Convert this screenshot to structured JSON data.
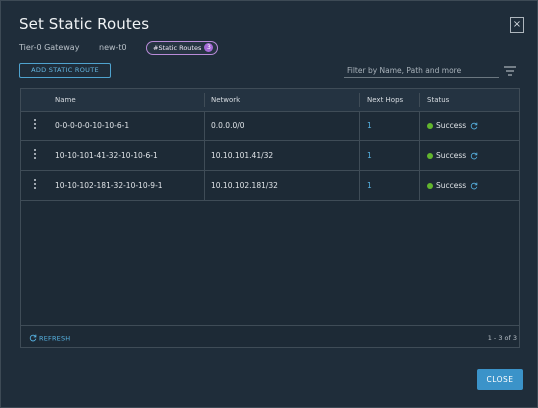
{
  "dialog": {
    "title": "Set Static Routes",
    "close_icon": "×"
  },
  "gateway": {
    "label": "Tier-0 Gateway",
    "value": "new-t0",
    "chip_label": "#Static Routes",
    "chip_count": "3"
  },
  "toolbar": {
    "add_label": "ADD STATIC ROUTE",
    "filter_placeholder": "Filter by Name, Path and more",
    "filter_icon": "filter-icon"
  },
  "table": {
    "columns": [
      "Name",
      "Network",
      "Next Hops",
      "Status"
    ],
    "rows": [
      {
        "name": "0-0-0-0-0-10-10-6-1",
        "network": "0.0.0.0/0",
        "next_hops": "1",
        "status": "Success"
      },
      {
        "name": "10-10-101-41-32-10-10-6-1",
        "network": "10.10.101.41/32",
        "next_hops": "1",
        "status": "Success"
      },
      {
        "name": "10-10-102-181-32-10-10-9-1",
        "network": "10.10.102.181/32",
        "next_hops": "1",
        "status": "Success"
      }
    ],
    "status_color": "#62b52e"
  },
  "footer": {
    "refresh_label": "REFRESH",
    "pager_text": "1 - 3 of 3"
  },
  "actions": {
    "close_label": "CLOSE"
  },
  "colors": {
    "accent": "#3b93c9",
    "link": "#57b3e3",
    "chip_border": "#b88bd8"
  }
}
